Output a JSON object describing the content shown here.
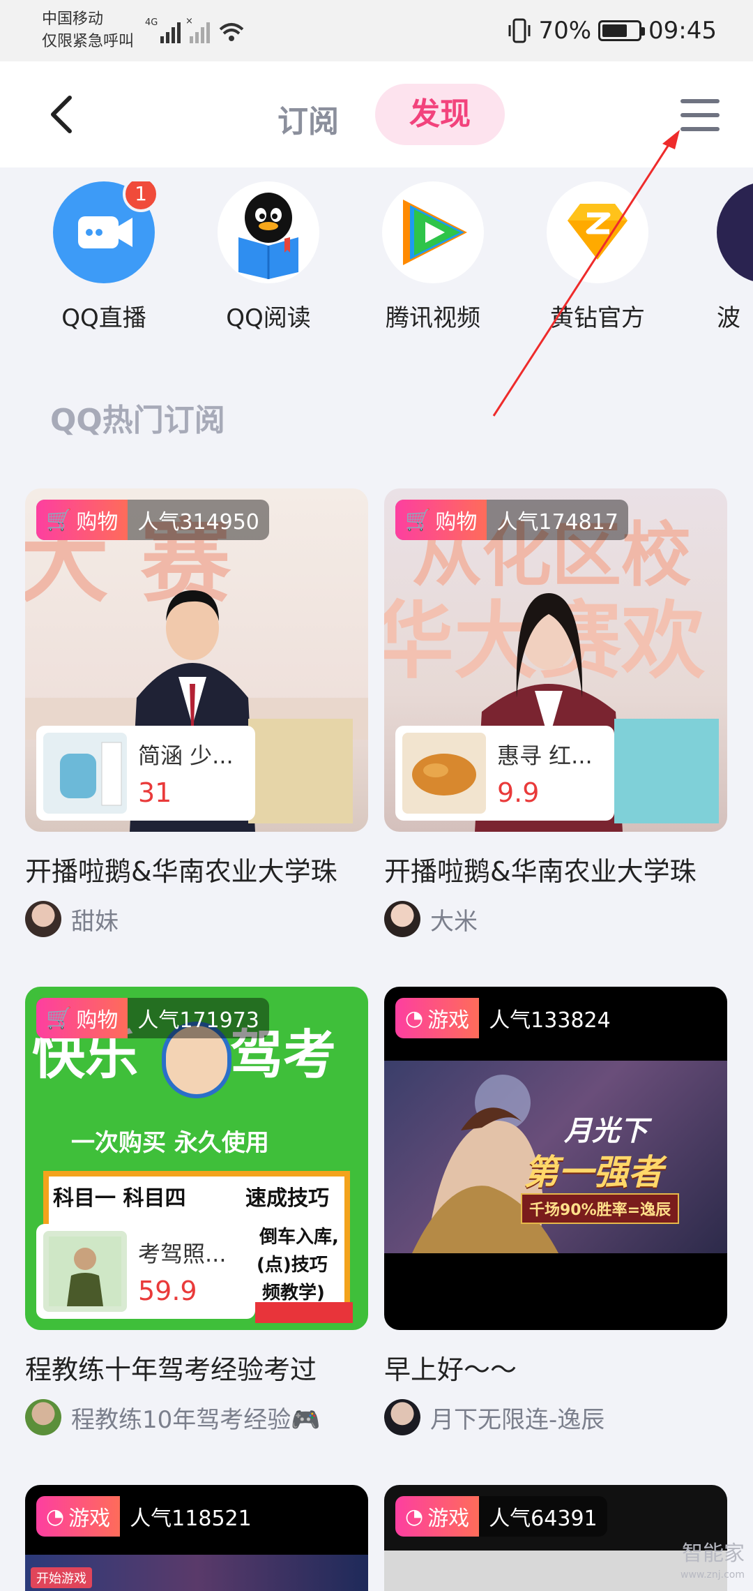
{
  "status_bar": {
    "carrier": "中国移动",
    "carrier_note": "仅限紧急呼叫",
    "battery_percent": "70%",
    "battery_level": 0.7,
    "time": "09:45"
  },
  "header": {
    "tab_subscribe": "订阅",
    "tab_discover": "发现",
    "active_tab": "发现"
  },
  "entries": [
    {
      "label": "QQ直播",
      "icon": "video-camera-icon",
      "badge": "1",
      "color": "#3d9bf7"
    },
    {
      "label": "QQ阅读",
      "icon": "penguin-reading-icon",
      "color": "#ffffff"
    },
    {
      "label": "腾讯视频",
      "icon": "play-icon",
      "color": "#ffffff"
    },
    {
      "label": "黄钻官方",
      "icon": "yellow-diamond-icon",
      "color": "#ffffff"
    },
    {
      "label": "波",
      "icon": "partial-app-icon",
      "color": "#2a2350"
    }
  ],
  "section": {
    "title": "QQ热门订阅"
  },
  "cards": [
    {
      "tag": "购物",
      "tag_icon": "cart-icon",
      "popularity": "人气314950",
      "goods_name": "简涵 少...",
      "goods_price": "31",
      "title": "开播啦鹅&华南农业大学珠",
      "author": "甜妹",
      "scene": "stage",
      "person_color": "#1f2235"
    },
    {
      "tag": "购物",
      "tag_icon": "cart-icon",
      "popularity": "人气174817",
      "goods_name": "惠寻 红...",
      "goods_price": "9.9",
      "title": "开播啦鹅&华南农业大学珠",
      "author": "大米",
      "scene": "stage",
      "person_color": "#7a2430"
    },
    {
      "tag": "购物",
      "tag_icon": "cart-icon",
      "popularity": "人气171973",
      "goods_name": "考驾照...",
      "goods_price": "59.9",
      "title": "程教练十年驾考经验考过",
      "author": "程教练10年驾考经验🎮",
      "scene": "driving",
      "poster_lines": [
        "快乐",
        "驾考",
        "一次购买 永久使用",
        "科目一  科目四",
        "速成技巧",
        "倒车入库,",
        "(点)技巧",
        "频教学)"
      ]
    },
    {
      "tag": "游戏",
      "tag_icon": "game-icon",
      "popularity": "人气133824",
      "title": "早上好～～",
      "author": "月下无限连-逸辰",
      "scene": "game",
      "poster_lines": [
        "月光下",
        "第一强者",
        "千场90%胜率=逸辰"
      ]
    },
    {
      "tag": "游戏",
      "tag_icon": "game-icon",
      "popularity": "人气118521",
      "strip_text": "开始游戏"
    },
    {
      "tag": "游戏",
      "tag_icon": "game-icon",
      "popularity": "人气64391"
    }
  ],
  "watermark": {
    "text": "智能家",
    "sub": "www.znj.com"
  },
  "colors": {
    "accent": "#f2437c",
    "price": "#e93a3a",
    "tag_gradient_start": "#fd3fa0",
    "tag_gradient_end": "#fe6c5a"
  }
}
